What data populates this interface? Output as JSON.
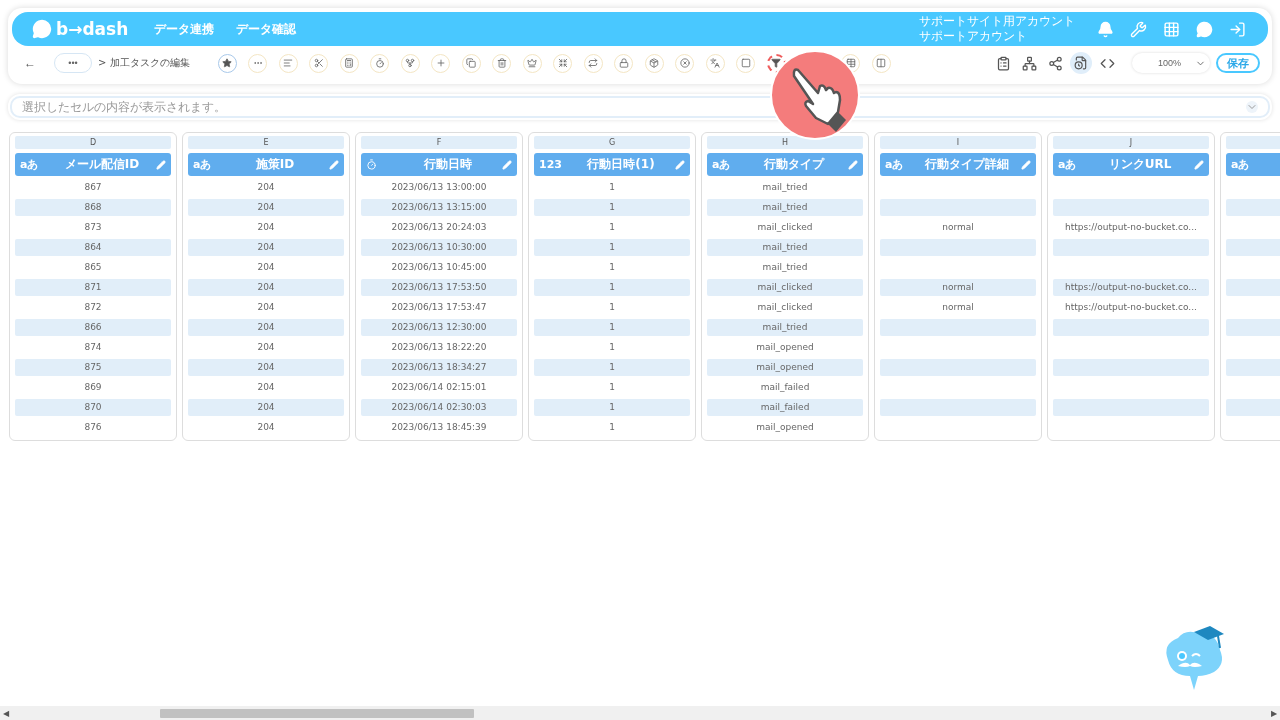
{
  "header": {
    "logo": "b→dash",
    "nav": [
      "データ連携",
      "データ確認"
    ],
    "account": [
      "サポートサイト用アカウント",
      "サポートアカウント"
    ]
  },
  "toolbar": {
    "back": "←",
    "more": "•••",
    "breadcrumb": "> 加工タスクの編集",
    "tools": [
      {
        "kind": "star",
        "selected": true
      },
      {
        "kind": "dots",
        "selected": false
      },
      {
        "kind": "lines",
        "selected": false
      },
      {
        "kind": "scissors",
        "selected": false
      },
      {
        "kind": "calc",
        "selected": false
      },
      {
        "kind": "timer",
        "selected": false
      },
      {
        "kind": "fork",
        "selected": false
      },
      {
        "kind": "plus",
        "selected": false
      },
      {
        "kind": "copy",
        "selected": false
      },
      {
        "kind": "trash",
        "selected": false
      },
      {
        "kind": "crown",
        "selected": false
      },
      {
        "kind": "shrink",
        "selected": false
      },
      {
        "kind": "repeat",
        "selected": false
      },
      {
        "kind": "lock",
        "selected": false
      },
      {
        "kind": "package",
        "selected": false
      },
      {
        "kind": "xcircle",
        "selected": false
      },
      {
        "kind": "translate",
        "selected": false
      },
      {
        "kind": "square",
        "selected": false
      },
      {
        "kind": "filter",
        "selected": true
      },
      {
        "kind": "table",
        "selected": false
      },
      {
        "kind": "split",
        "selected": false
      }
    ],
    "zoom": "100%",
    "save": "保存"
  },
  "scrollbar": {
    "left": "◀",
    "right": "▶"
  },
  "formula_bar": {
    "placeholder": "選択したセルの内容が表示されます。"
  },
  "columns": [
    {
      "letter": "D",
      "title": "メール配信ID",
      "kind": "text",
      "type_label": "aあ"
    },
    {
      "letter": "E",
      "title": "施策ID",
      "kind": "text",
      "type_label": "aあ"
    },
    {
      "letter": "F",
      "title": "行動日時",
      "kind": "datetime"
    },
    {
      "letter": "G",
      "title": "行動日時(1)",
      "kind": "number",
      "type_label": "123"
    },
    {
      "letter": "H",
      "title": "行動タイプ",
      "kind": "text",
      "type_label": "aあ"
    },
    {
      "letter": "I",
      "title": "行動タイプ詳細",
      "kind": "text",
      "type_label": "aあ"
    },
    {
      "letter": "J",
      "title": "リンクURL",
      "kind": "text",
      "type_label": "aあ"
    },
    {
      "kind": "text",
      "type_label": "aあ"
    }
  ],
  "rows": [
    [
      "867",
      "204",
      "2023/06/13 13:00:00",
      "1",
      "mail_tried",
      null,
      null
    ],
    [
      "868",
      "204",
      "2023/06/13 13:15:00",
      "1",
      "mail_tried",
      null,
      null
    ],
    [
      "873",
      "204",
      "2023/06/13 20:24:03",
      "1",
      "mail_clicked",
      "normal",
      "https://output-no-bucket.co..."
    ],
    [
      "864",
      "204",
      "2023/06/13 10:30:00",
      "1",
      "mail_tried",
      null,
      null
    ],
    [
      "865",
      "204",
      "2023/06/13 10:45:00",
      "1",
      "mail_tried",
      null,
      null
    ],
    [
      "871",
      "204",
      "2023/06/13 17:53:50",
      "1",
      "mail_clicked",
      "normal",
      "https://output-no-bucket.co..."
    ],
    [
      "872",
      "204",
      "2023/06/13 17:53:47",
      "1",
      "mail_clicked",
      "normal",
      "https://output-no-bucket.co..."
    ],
    [
      "866",
      "204",
      "2023/06/13 12:30:00",
      "1",
      "mail_tried",
      null,
      null
    ],
    [
      "874",
      "204",
      "2023/06/13 18:22:20",
      "1",
      "mail_opened",
      null,
      null
    ],
    [
      "875",
      "204",
      "2023/06/13 18:34:27",
      "1",
      "mail_opened",
      null,
      null
    ],
    [
      "869",
      "204",
      "2023/06/14 02:15:01",
      "1",
      "mail_failed",
      null,
      null
    ],
    [
      "870",
      "204",
      "2023/06/14 02:30:03",
      "1",
      "mail_failed",
      null,
      null
    ],
    [
      "876",
      "204",
      "2023/06/13 18:45:39",
      "1",
      "mail_opened",
      null,
      null
    ]
  ]
}
